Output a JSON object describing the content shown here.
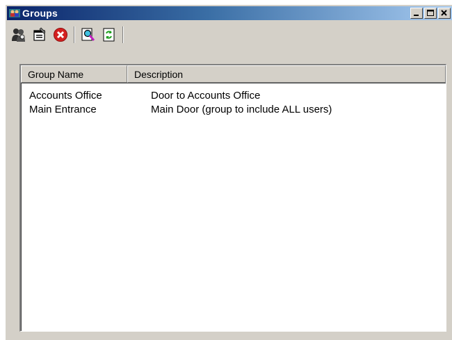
{
  "window": {
    "title": "Groups"
  },
  "toolbar": {
    "buttons": [
      {
        "name": "add-group-icon"
      },
      {
        "name": "properties-icon"
      },
      {
        "name": "delete-icon"
      },
      {
        "name": "find-icon"
      },
      {
        "name": "refresh-icon"
      }
    ]
  },
  "list": {
    "columns": [
      "Group Name",
      "Description"
    ],
    "rows": [
      {
        "name": "Accounts Office",
        "description": "Door to Accounts Office"
      },
      {
        "name": "Main Entrance",
        "description": "Main Door (group to include ALL users)"
      }
    ]
  },
  "colors": {
    "titlebar_start": "#0a246a",
    "titlebar_end": "#a6caf0",
    "face": "#d4d0c8"
  }
}
